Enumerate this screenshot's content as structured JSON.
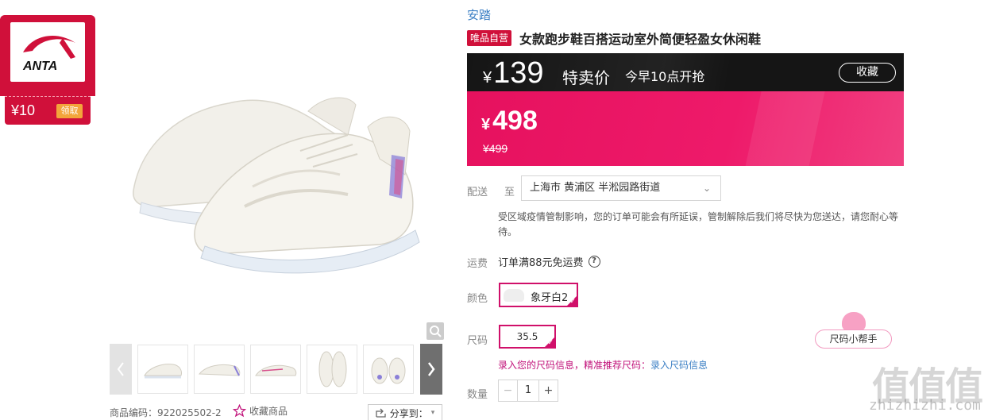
{
  "coupon": {
    "brand_logo_text": "ANTA",
    "amount": "¥10",
    "claim_label": "领取"
  },
  "product": {
    "brand": "安踏",
    "badge": "唯品自营",
    "title": "女款跑步鞋百搭运动室外简便轻盈女休闲鞋",
    "sku_label": "商品编码：922025502-2",
    "favorite_label": "收藏商品",
    "share_label": "分享到：",
    "thumbnails": [
      "thumb-1",
      "thumb-2",
      "thumb-3",
      "thumb-4",
      "thumb-5"
    ]
  },
  "flash_sale": {
    "currency": "¥",
    "price": "139",
    "label": "特卖价",
    "start_time": "今早10点开抢",
    "favorite_button": "收藏"
  },
  "price": {
    "currency": "¥",
    "current": "498",
    "original": "¥499"
  },
  "delivery": {
    "label": "配送",
    "to_label": "至",
    "address": "上海市 黄浦区 半淞园路街道",
    "notice": "受区域疫情管制影响，您的订单可能会有所延误，管制解除后我们将尽快为您送达，请您耐心等待。"
  },
  "shipping_fee": {
    "label": "运费",
    "value": "订单满88元免运费"
  },
  "color": {
    "label": "颜色",
    "selected": "象牙白2"
  },
  "size": {
    "label": "尺码",
    "selected": "35.5",
    "helper_button": "尺码小帮手",
    "tip_prefix": "录入您的尺码信息，精准推荐尺码：",
    "tip_link": "录入尺码信息"
  },
  "quantity": {
    "label": "数量",
    "value": "1",
    "minus": "−",
    "plus": "+"
  },
  "watermark": {
    "logo": "值值值",
    "site": "zhizhizhi.com"
  },
  "colors": {
    "vip_red": "#d0103a",
    "price_pink": "#ee1a6a",
    "flash_bar": "#151515",
    "link_blue": "#3b7fc4"
  },
  "icons": [
    "anta-logo-icon",
    "zoom-icon",
    "chevron-left-icon",
    "chevron-right-icon",
    "star-icon",
    "share-icon",
    "chevron-down-icon",
    "help-icon",
    "check-icon"
  ]
}
